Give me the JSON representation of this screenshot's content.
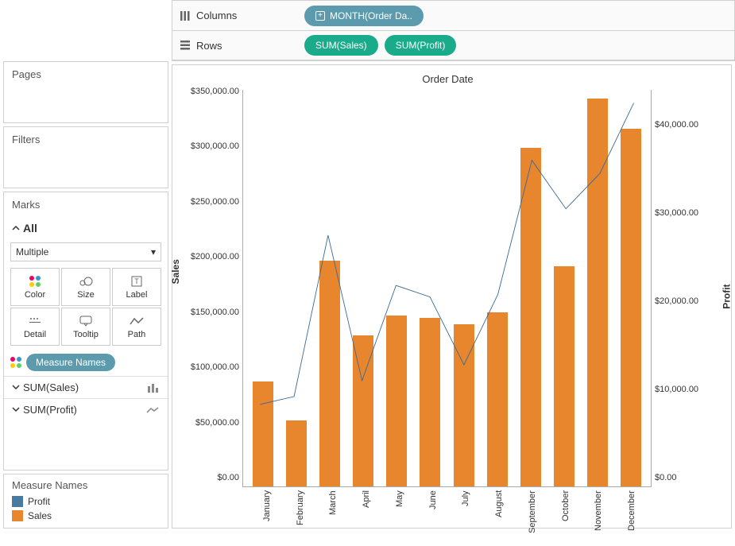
{
  "shelves": {
    "columns_label": "Columns",
    "rows_label": "Rows",
    "columns_pill": "MONTH(Order Da..",
    "rows_pill_1": "SUM(Sales)",
    "rows_pill_2": "SUM(Profit)"
  },
  "sidebar": {
    "pages_title": "Pages",
    "filters_title": "Filters",
    "marks_title": "Marks",
    "all_label": "All",
    "mark_type": "Multiple",
    "buttons": {
      "color": "Color",
      "size": "Size",
      "label": "Label",
      "detail": "Detail",
      "tooltip": "Tooltip",
      "path": "Path"
    },
    "measure_names_pill": "Measure Names",
    "sum_sales": "SUM(Sales)",
    "sum_profit": "SUM(Profit)",
    "legend_title": "Measure Names",
    "legend_profit": "Profit",
    "legend_sales": "Sales"
  },
  "chart": {
    "title": "Order Date",
    "left_axis": "Sales",
    "right_axis": "Profit"
  },
  "chart_data": {
    "type": "bar+line",
    "title": "Order Date",
    "categories": [
      "January",
      "February",
      "March",
      "April",
      "May",
      "June",
      "July",
      "August",
      "September",
      "October",
      "November",
      "December"
    ],
    "series": [
      {
        "name": "Sales",
        "type": "bar",
        "axis": "left",
        "values": [
          95000,
          60000,
          205000,
          137000,
          155000,
          153000,
          147000,
          158000,
          307000,
          200000,
          352000,
          325000
        ]
      },
      {
        "name": "Profit",
        "type": "line",
        "axis": "right",
        "values": [
          9300,
          10200,
          28500,
          12000,
          22800,
          21500,
          13800,
          21800,
          37000,
          31500,
          35500,
          43500
        ]
      }
    ],
    "left_axis": {
      "label": "Sales",
      "min": 0,
      "max": 360000,
      "ticks": [
        0,
        50000,
        100000,
        150000,
        200000,
        250000,
        300000,
        350000
      ],
      "tick_labels": [
        "$0.00",
        "$50,000.00",
        "$100,000.00",
        "$150,000.00",
        "$200,000.00",
        "$250,000.00",
        "$300,000.00",
        "$350,000.00"
      ]
    },
    "right_axis": {
      "label": "Profit",
      "min": 0,
      "max": 45000,
      "ticks": [
        0,
        10000,
        20000,
        30000,
        40000
      ],
      "tick_labels": [
        "$0.00",
        "$10,000.00",
        "$20,000.00",
        "$30,000.00",
        "$40,000.00"
      ]
    }
  }
}
